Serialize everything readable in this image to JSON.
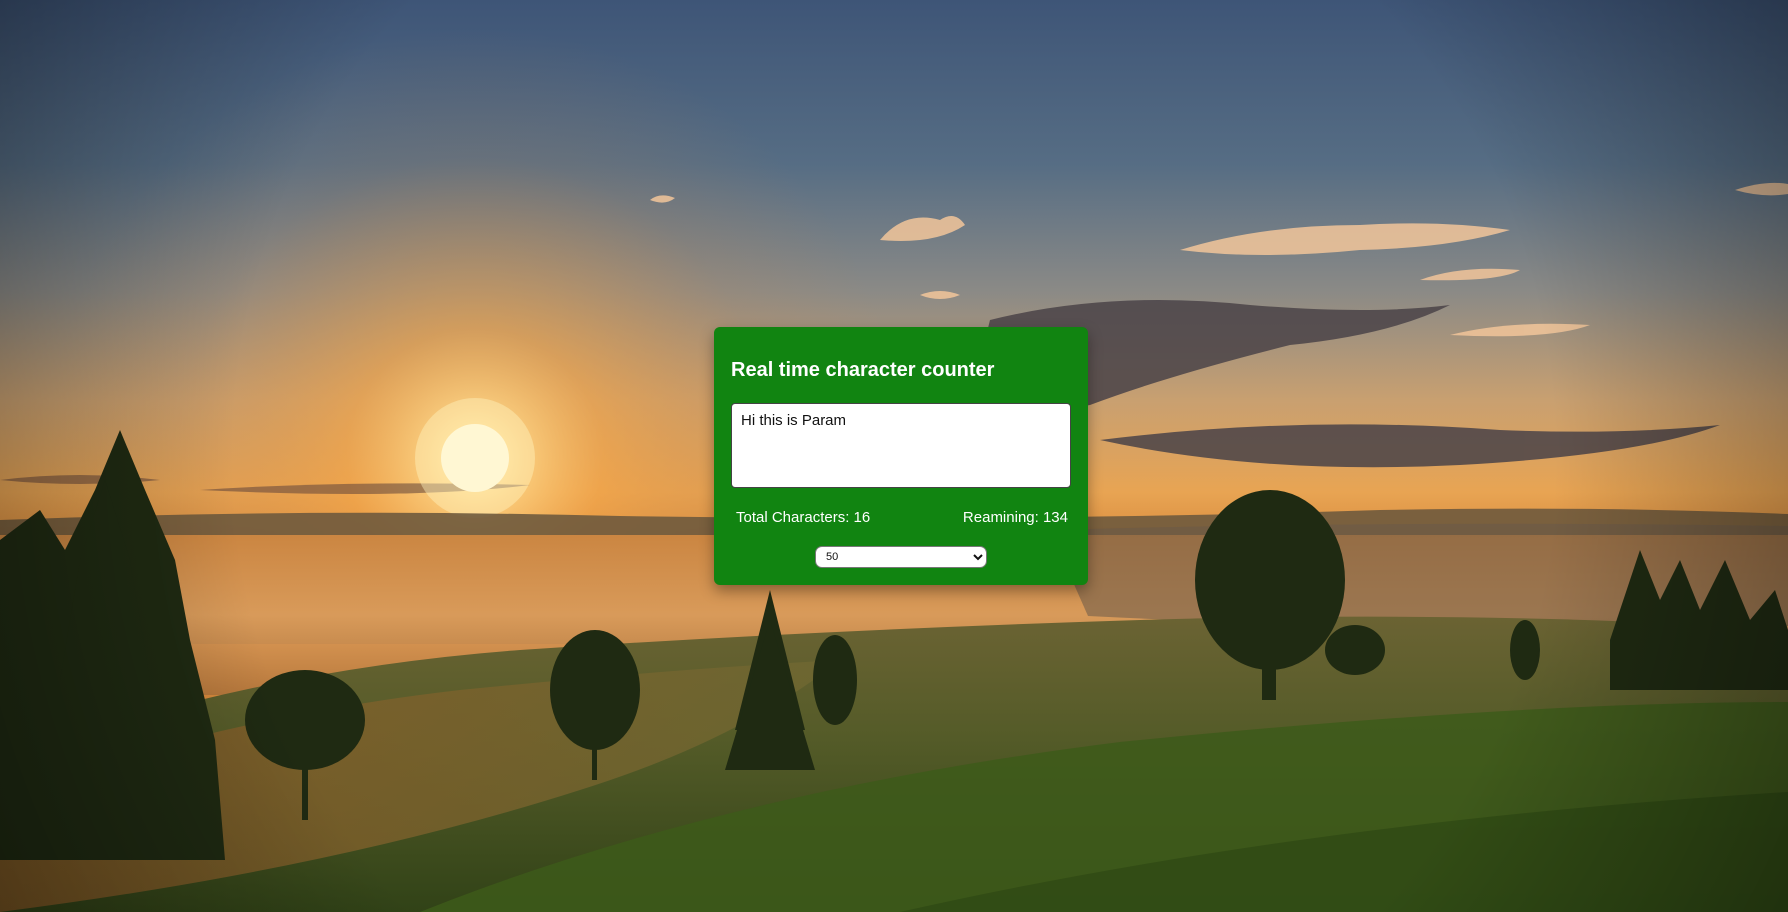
{
  "background": {
    "description_icon": "sunset-landscape-image"
  },
  "card": {
    "title": "Real time character counter",
    "accent_color": "#118411",
    "textarea": {
      "value": "Hi this is Param"
    },
    "total": {
      "label": "Total Characters: 16"
    },
    "remaining": {
      "label": "Reamining: 134"
    },
    "limit_select": {
      "selected": "50"
    }
  }
}
